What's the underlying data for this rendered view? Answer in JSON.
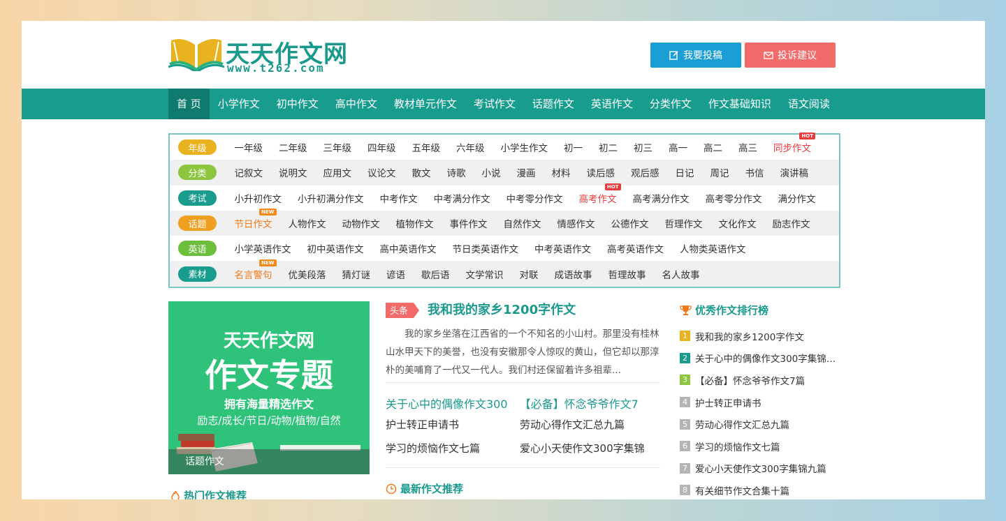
{
  "logo": {
    "title": "天天作文网",
    "url": "www.t262.com"
  },
  "header": {
    "submit_label": "我要投稿",
    "complain_label": "投诉建议"
  },
  "nav": {
    "items": [
      "首 页",
      "小学作文",
      "初中作文",
      "高中作文",
      "教材单元作文",
      "考试作文",
      "话题作文",
      "英语作文",
      "分类作文",
      "作文基础知识",
      "语文阅读"
    ]
  },
  "categories": [
    {
      "tag": "年级",
      "color": "#e9b320",
      "links": [
        {
          "text": "一年级"
        },
        {
          "text": "二年级"
        },
        {
          "text": "三年级"
        },
        {
          "text": "四年级"
        },
        {
          "text": "五年级"
        },
        {
          "text": "六年级"
        },
        {
          "text": "小学生作文"
        },
        {
          "text": "初一"
        },
        {
          "text": "初二"
        },
        {
          "text": "初三"
        },
        {
          "text": "高一"
        },
        {
          "text": "高二"
        },
        {
          "text": "高三"
        },
        {
          "text": "同步作文",
          "style": "red",
          "badge": "HOT"
        }
      ]
    },
    {
      "tag": "分类",
      "color": "#8cc63f",
      "links": [
        {
          "text": "记叙文"
        },
        {
          "text": "说明文"
        },
        {
          "text": "应用文"
        },
        {
          "text": "议论文"
        },
        {
          "text": "散文"
        },
        {
          "text": "诗歌"
        },
        {
          "text": "小说"
        },
        {
          "text": "漫画"
        },
        {
          "text": "材料"
        },
        {
          "text": "读后感"
        },
        {
          "text": "观后感"
        },
        {
          "text": "日记"
        },
        {
          "text": "周记"
        },
        {
          "text": "书信"
        },
        {
          "text": "演讲稿"
        }
      ]
    },
    {
      "tag": "考试",
      "color": "#179c8e",
      "links": [
        {
          "text": "小升初作文"
        },
        {
          "text": "小升初满分作文"
        },
        {
          "text": "中考作文"
        },
        {
          "text": "中考满分作文"
        },
        {
          "text": "中考零分作文"
        },
        {
          "text": "高考作文",
          "style": "red",
          "badge": "HOT"
        },
        {
          "text": "高考满分作文"
        },
        {
          "text": "高考零分作文"
        },
        {
          "text": "满分作文"
        }
      ]
    },
    {
      "tag": "话题",
      "color": "#f0a020",
      "links": [
        {
          "text": "节日作文",
          "style": "orange",
          "badge": "NEW"
        },
        {
          "text": "人物作文"
        },
        {
          "text": "动物作文"
        },
        {
          "text": "植物作文"
        },
        {
          "text": "事件作文"
        },
        {
          "text": "自然作文"
        },
        {
          "text": "情感作文"
        },
        {
          "text": "公德作文"
        },
        {
          "text": "哲理作文"
        },
        {
          "text": "文化作文"
        },
        {
          "text": "励志作文"
        }
      ]
    },
    {
      "tag": "英语",
      "color": "#6cbf3c",
      "links": [
        {
          "text": "小学英语作文"
        },
        {
          "text": "初中英语作文"
        },
        {
          "text": "高中英语作文"
        },
        {
          "text": "节日类英语作文"
        },
        {
          "text": "中考英语作文"
        },
        {
          "text": "高考英语作文"
        },
        {
          "text": "人物类英语作文"
        }
      ]
    },
    {
      "tag": "素材",
      "color": "#179c8e",
      "links": [
        {
          "text": "名言警句",
          "style": "orange",
          "badge": "NEW"
        },
        {
          "text": "优美段落"
        },
        {
          "text": "猜灯谜"
        },
        {
          "text": "谚语"
        },
        {
          "text": "歇后语"
        },
        {
          "text": "文学常识"
        },
        {
          "text": "对联"
        },
        {
          "text": "成语故事"
        },
        {
          "text": "哲理故事"
        },
        {
          "text": "名人故事"
        }
      ]
    }
  ],
  "banner": {
    "line1": "天天作文网",
    "line2": "作文专题",
    "line3": "拥有海量精选作文",
    "line4": "励志/成长/节日/动物/植物/自然",
    "caption": "话题作文"
  },
  "hot_recommend": "热门作文推荐",
  "headline": {
    "tag": "头条",
    "title": "我和我的家乡1200字作文",
    "desc": "我的家乡坐落在江西省的一个不知名的小山村。那里没有桂林山水甲天下的美誉，也没有安徽那令人惊叹的黄山，但它却以那淳朴的美哺育了一代又一代人。我们村还保留着许多祖辈..."
  },
  "mid_links": [
    "关于心中的偶像作文300",
    "【必备】怀念爷爷作文7"
  ],
  "mid_grid": [
    "护士转正申请书",
    "劳动心得作文汇总九篇",
    "学习的烦恼作文七篇",
    "爱心小天使作文300字集锦"
  ],
  "latest": "最新作文推荐",
  "rank": {
    "title": "优秀作文排行榜",
    "items": [
      {
        "n": "1",
        "text": "我和我的家乡1200字作文",
        "color": "#e9b320"
      },
      {
        "n": "2",
        "text": "关于心中的偶像作文300字集锦1...",
        "color": "#179c8e"
      },
      {
        "n": "3",
        "text": "【必备】怀念爷爷作文7篇",
        "color": "#8cc63f"
      },
      {
        "n": "4",
        "text": "护士转正申请书",
        "color": "#b5b5b5"
      },
      {
        "n": "5",
        "text": "劳动心得作文汇总九篇",
        "color": "#b5b5b5"
      },
      {
        "n": "6",
        "text": "学习的烦恼作文七篇",
        "color": "#b5b5b5"
      },
      {
        "n": "7",
        "text": "爱心小天使作文300字集锦九篇",
        "color": "#b5b5b5"
      },
      {
        "n": "8",
        "text": "有关细节作文合集十篇",
        "color": "#b5b5b5"
      }
    ]
  }
}
